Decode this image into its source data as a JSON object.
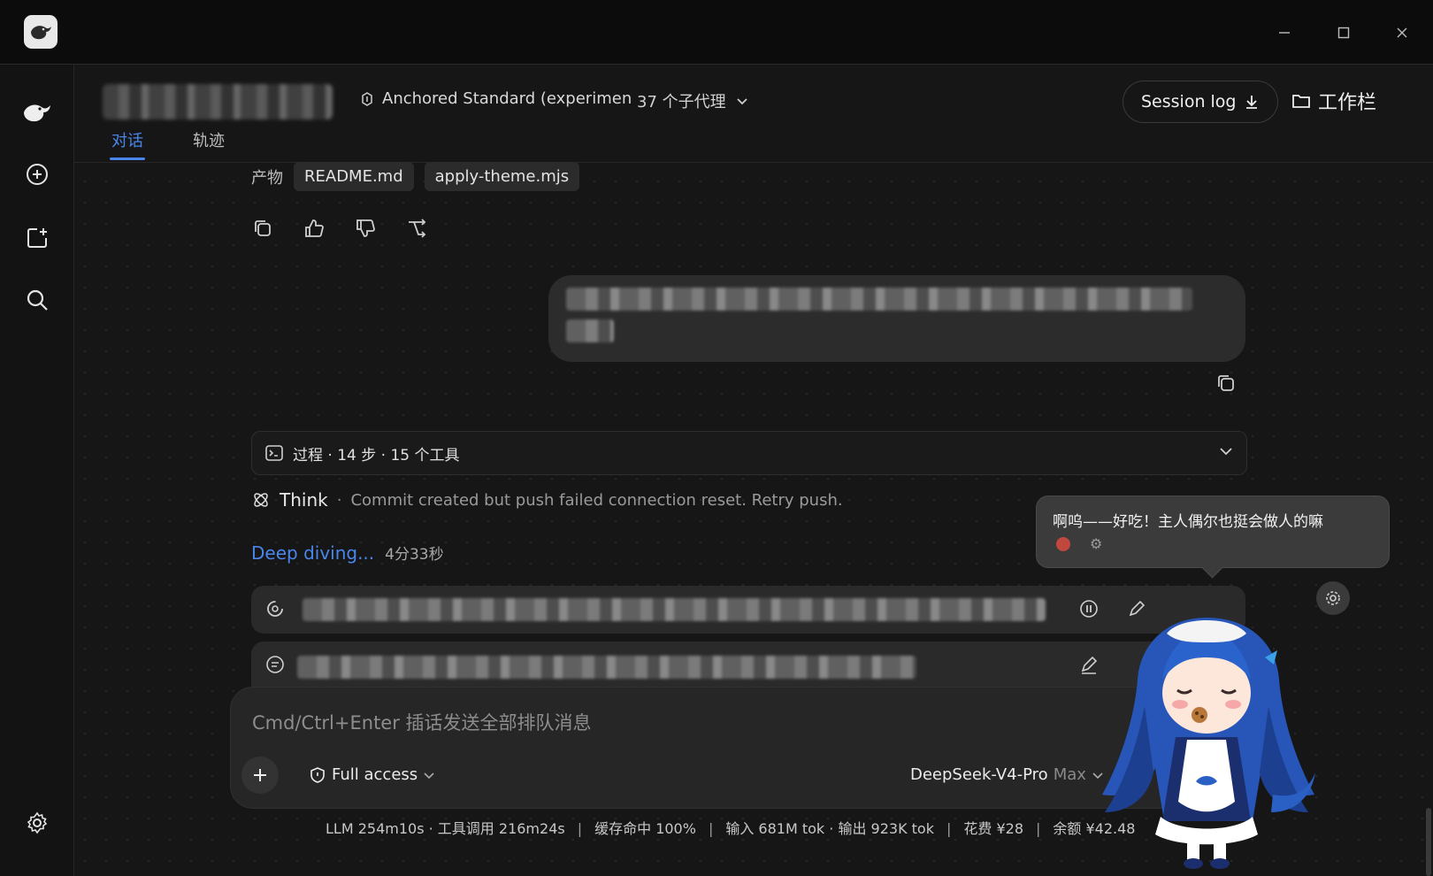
{
  "window": {
    "controls": [
      "minimize",
      "maximize",
      "close"
    ]
  },
  "sidebar": {
    "icons": [
      "deepseek-logo-icon",
      "new-chat-icon",
      "new-project-icon",
      "search-icon",
      "settings-icon"
    ]
  },
  "header": {
    "preset_label": "Anchored Standard (experimen",
    "agents_label": "37 个子代理",
    "session_log_label": "Session log",
    "workbar_label": "工作栏",
    "tabs": [
      {
        "label": "对话",
        "active": true
      },
      {
        "label": "轨迹",
        "active": false
      }
    ]
  },
  "conversation": {
    "artifacts_label": "产物",
    "artifacts": [
      "README.md",
      "apply-theme.mjs"
    ],
    "process_label": "过程 · 14 步 · 15 个工具",
    "think_label": "Think",
    "think_message": "Commit created but push failed connection reset. Retry push.",
    "deep_diving_label": "Deep diving...",
    "elapsed": "4分33秒"
  },
  "composer": {
    "placeholder": "Cmd/Ctrl+Enter 插话发送全部排队消息",
    "access_label": "Full access",
    "model_name": "DeepSeek-V4-Pro",
    "model_mode": "Max"
  },
  "status": {
    "llm": "LLM 254m10s · 工具调用 216m24s",
    "cache": "缓存命中 100%",
    "tokens": "输入 681M tok · 输出 923K tok",
    "cost": "花费 ¥28",
    "balance": "余额 ¥42.48"
  },
  "mascot": {
    "speech": "啊呜——好吃！主人偶尔也挺会做人的嘛"
  },
  "colors": {
    "accent": "#4a86ea",
    "background": "#161616",
    "sidebar": "#131313",
    "bubble": "#2c2c2c"
  }
}
